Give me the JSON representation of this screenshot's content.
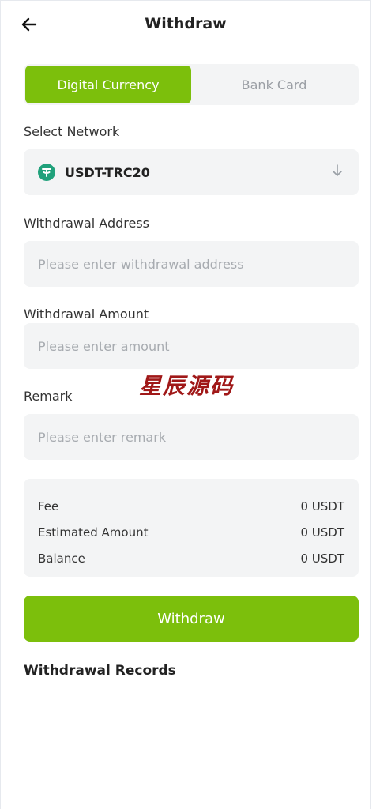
{
  "header": {
    "title": "Withdraw",
    "back_icon": "arrow-left-icon"
  },
  "tabs": [
    {
      "label": "Digital Currency",
      "active": true
    },
    {
      "label": "Bank Card",
      "active": false
    }
  ],
  "network": {
    "label": "Select Network",
    "selected": "USDT-TRC20",
    "icon": "tether-icon",
    "chevron_icon": "arrow-down-icon"
  },
  "address": {
    "label": "Withdrawal Address",
    "value": "",
    "placeholder": "Please enter withdrawal address"
  },
  "amount": {
    "label": "Withdrawal Amount",
    "value": "",
    "placeholder": "Please enter amount"
  },
  "watermark": "星辰源码",
  "remark": {
    "label": "Remark",
    "value": "",
    "placeholder": "Please enter remark"
  },
  "summary": {
    "fee_label": "Fee",
    "fee_value": "0 USDT",
    "estimated_label": "Estimated Amount",
    "estimated_value": "0 USDT",
    "balance_label": "Balance",
    "balance_value": "0 USDT"
  },
  "withdraw_button": "Withdraw",
  "records_title": "Withdrawal Records",
  "colors": {
    "accent": "#7cbf0c",
    "field_bg": "#f3f4f5",
    "tether": "#20a17b",
    "watermark": "#a01818"
  }
}
